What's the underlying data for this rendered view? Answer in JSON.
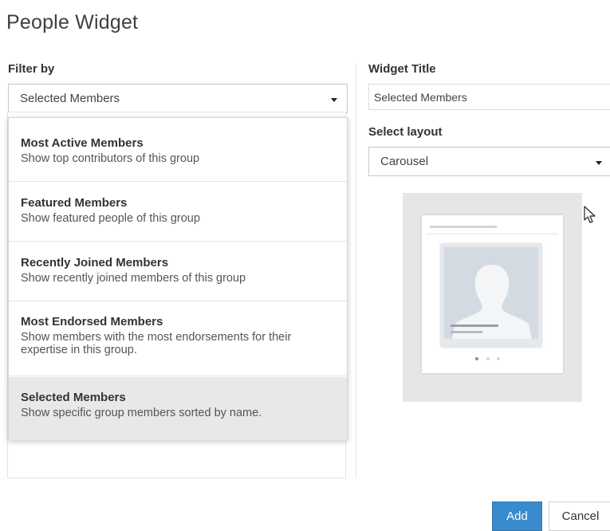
{
  "page": {
    "title": "People Widget"
  },
  "filter": {
    "label": "Filter by",
    "selected_value": "Selected Members",
    "options": [
      {
        "name": "Most Active Members",
        "description": "Show top contributors of this group"
      },
      {
        "name": "Featured Members",
        "description": "Show featured people of this group"
      },
      {
        "name": "Recently Joined Members",
        "description": "Show recently joined members of this group"
      },
      {
        "name": "Most Endorsed Members",
        "description": "Show members with the most endorsements for their expertise in this group."
      },
      {
        "name": "Selected Members",
        "description": "Show specific group members sorted by name."
      }
    ]
  },
  "widget_title": {
    "label": "Widget Title",
    "value": "Selected Members"
  },
  "layout": {
    "label": "Select layout",
    "selected_value": "Carousel"
  },
  "buttons": {
    "add": "Add",
    "cancel": "Cancel"
  },
  "colors": {
    "primary": "#3a8bcd",
    "highlight": "#e8e8e8",
    "preview_bg": "#e6e6e6"
  }
}
